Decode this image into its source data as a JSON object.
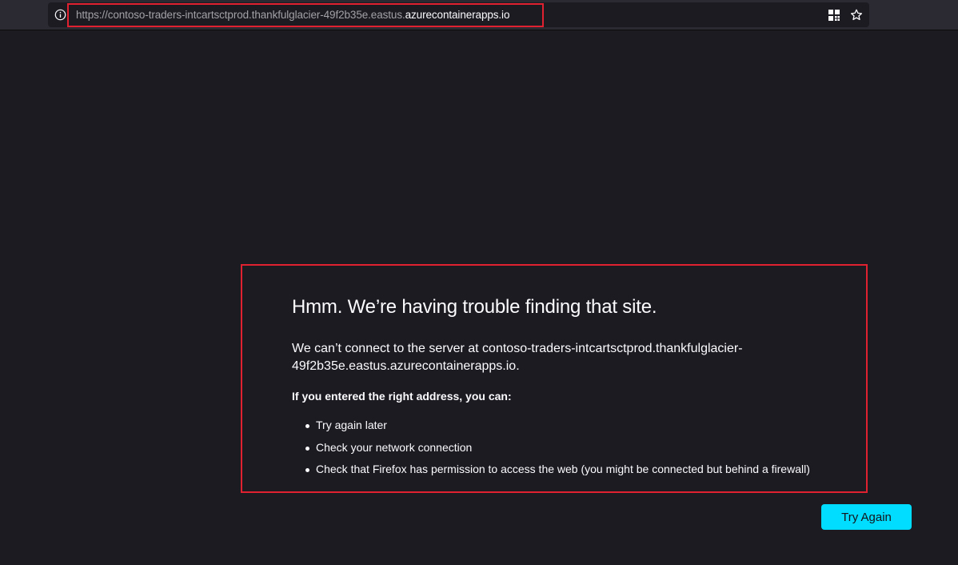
{
  "browser": {
    "url_prefix": "https://contoso-traders-intcartsctprod.thankfulglacier-49f2b35e.eastus.",
    "url_host": "azurecontainerapps.io",
    "icons": [
      "info-icon",
      "qr-code-icon",
      "bookmark-star-icon"
    ]
  },
  "error": {
    "title": "Hmm. We’re having trouble finding that site.",
    "description": "We can’t connect to the server at contoso-traders-intcartsctprod.thankfulglacier-49f2b35e.eastus.azurecontainerapps.io.",
    "suggestion_heading": "If you entered the right address, you can:",
    "suggestions": [
      "Try again later",
      "Check your network connection",
      "Check that Firefox has permission to access the web (you might be connected but behind a firewall)"
    ],
    "button_label": "Try Again"
  },
  "colors": {
    "page_background": "#1c1b22",
    "toolbar_background": "#2b2a33",
    "highlight_border": "#e0212f",
    "button_accent": "#00ddff"
  }
}
